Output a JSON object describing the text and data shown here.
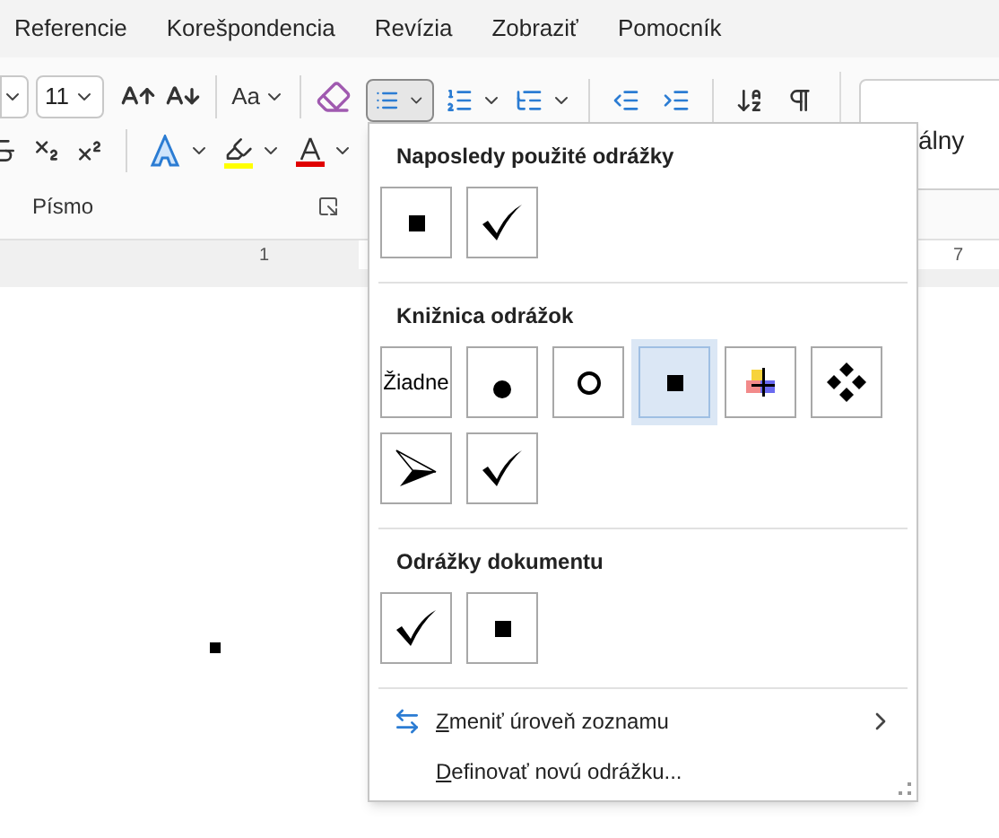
{
  "tabs": [
    {
      "label": "Referencie"
    },
    {
      "label": "Korešpondencia"
    },
    {
      "label": "Revízia"
    },
    {
      "label": "Zobraziť"
    },
    {
      "label": "Pomocník"
    }
  ],
  "ribbon": {
    "font_size": "11",
    "case_label": "Aa",
    "group_label": "Písmo",
    "bullets_pressed": true,
    "style_label": "álny"
  },
  "ruler": {
    "labels": [
      "1",
      "7"
    ]
  },
  "bullet_menu": {
    "sections": [
      {
        "title": "Naposledy použité odrážky",
        "items": [
          {
            "kind": "square",
            "selected": false
          },
          {
            "kind": "check",
            "selected": false
          }
        ]
      },
      {
        "title": "Knižnica odrážok",
        "items": [
          {
            "kind": "none",
            "label": "Žiadne",
            "selected": false
          },
          {
            "kind": "dot",
            "selected": false
          },
          {
            "kind": "circle",
            "selected": false
          },
          {
            "kind": "square",
            "selected": true
          },
          {
            "kind": "picture",
            "selected": false
          },
          {
            "kind": "diamonds",
            "selected": false
          },
          {
            "kind": "arrowhead",
            "selected": false
          },
          {
            "kind": "check",
            "selected": false
          }
        ]
      },
      {
        "title": "Odrážky dokumentu",
        "items": [
          {
            "kind": "check",
            "selected": false
          },
          {
            "kind": "square",
            "selected": false
          }
        ]
      }
    ],
    "commands": [
      {
        "kind": "level",
        "label": "Zmeniť úroveň zoznamu",
        "submenu": true
      },
      {
        "kind": "define",
        "label": "Definovať novú odrážku...",
        "submenu": false
      }
    ]
  }
}
